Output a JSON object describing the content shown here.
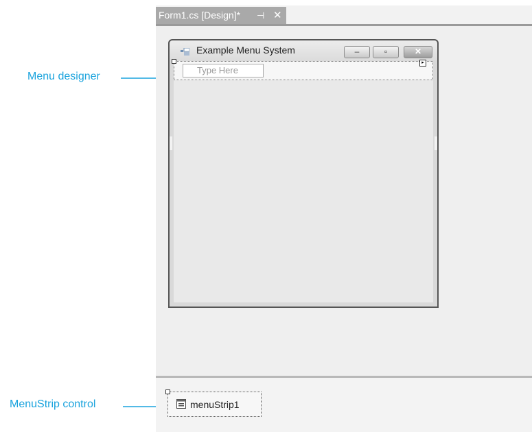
{
  "tab": {
    "title": "Form1.cs [Design]*",
    "pin_glyph": "⊣",
    "close_glyph": "✕"
  },
  "form": {
    "title": "Example Menu System",
    "minimize_glyph": "–",
    "maximize_glyph": "▫",
    "close_glyph": "✕",
    "menu_placeholder": "Type Here"
  },
  "tray": {
    "component_label": "menuStrip1"
  },
  "callouts": {
    "menu_designer": "Menu designer",
    "menustrip_control": "MenuStrip control"
  },
  "colors": {
    "callout": "#1aa3dd"
  }
}
